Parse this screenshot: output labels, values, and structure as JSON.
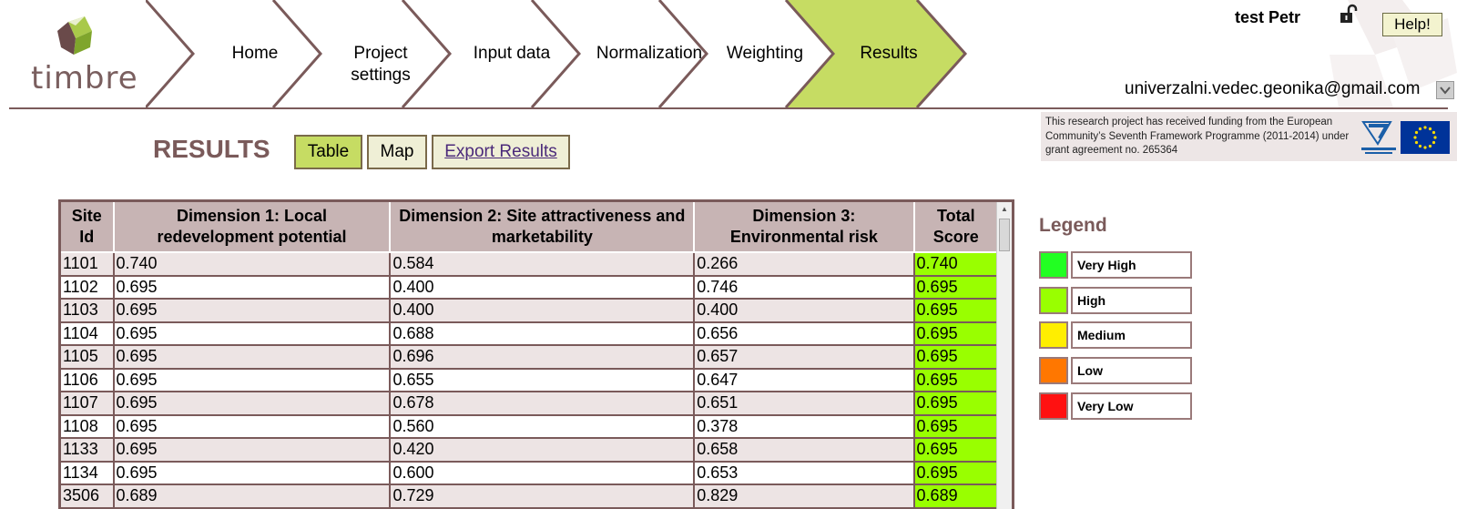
{
  "app": {
    "logo_text": "timbre"
  },
  "nav": {
    "items": [
      {
        "label": "Home"
      },
      {
        "label": "Project settings"
      },
      {
        "label": "Input data"
      },
      {
        "label": "Normalization"
      },
      {
        "label": "Weighting"
      },
      {
        "label": "Results"
      }
    ],
    "active": "Results",
    "colors": {
      "active": "#c6dc63",
      "border": "#7a5a5a"
    }
  },
  "user": {
    "name": "test Petr",
    "email": "univerzalni.vedec.geonika@gmail.com",
    "help_label": "Help!",
    "lock_icon": "lock-open-icon"
  },
  "funding": {
    "text": "This research project has received funding from the European Community’s Seventh Framework Programme (2011-2014) under grant agreement no. 265364"
  },
  "results": {
    "title": "RESULTS",
    "buttons": {
      "table": "Table",
      "map": "Map",
      "export": "Export Results"
    },
    "active_view": "Table"
  },
  "table": {
    "headers": [
      "Site Id",
      "Dimension 1: Local redevelopment potential",
      "Dimension 2: Site attractiveness and marketability",
      "Dimension 3: Environmental risk",
      "Total Score"
    ],
    "rows": [
      [
        "1101",
        "0.740",
        "0.584",
        "0.266",
        "0.740"
      ],
      [
        "1102",
        "0.695",
        "0.400",
        "0.746",
        "0.695"
      ],
      [
        "1103",
        "0.695",
        "0.400",
        "0.400",
        "0.695"
      ],
      [
        "1104",
        "0.695",
        "0.688",
        "0.656",
        "0.695"
      ],
      [
        "1105",
        "0.695",
        "0.696",
        "0.657",
        "0.695"
      ],
      [
        "1106",
        "0.695",
        "0.655",
        "0.647",
        "0.695"
      ],
      [
        "1107",
        "0.695",
        "0.678",
        "0.651",
        "0.695"
      ],
      [
        "1108",
        "0.695",
        "0.560",
        "0.378",
        "0.695"
      ],
      [
        "1133",
        "0.695",
        "0.420",
        "0.658",
        "0.695"
      ],
      [
        "1134",
        "0.695",
        "0.600",
        "0.653",
        "0.695"
      ],
      [
        "3506",
        "0.689",
        "0.729",
        "0.829",
        "0.689"
      ]
    ],
    "score_color": "#99ff00"
  },
  "legend": {
    "title": "Legend",
    "items": [
      {
        "label": "Very High",
        "color": "#22ff22"
      },
      {
        "label": "High",
        "color": "#99ff00"
      },
      {
        "label": "Medium",
        "color": "#ffee00"
      },
      {
        "label": "Low",
        "color": "#ff7700"
      },
      {
        "label": "Very Low",
        "color": "#ff1111"
      }
    ]
  }
}
